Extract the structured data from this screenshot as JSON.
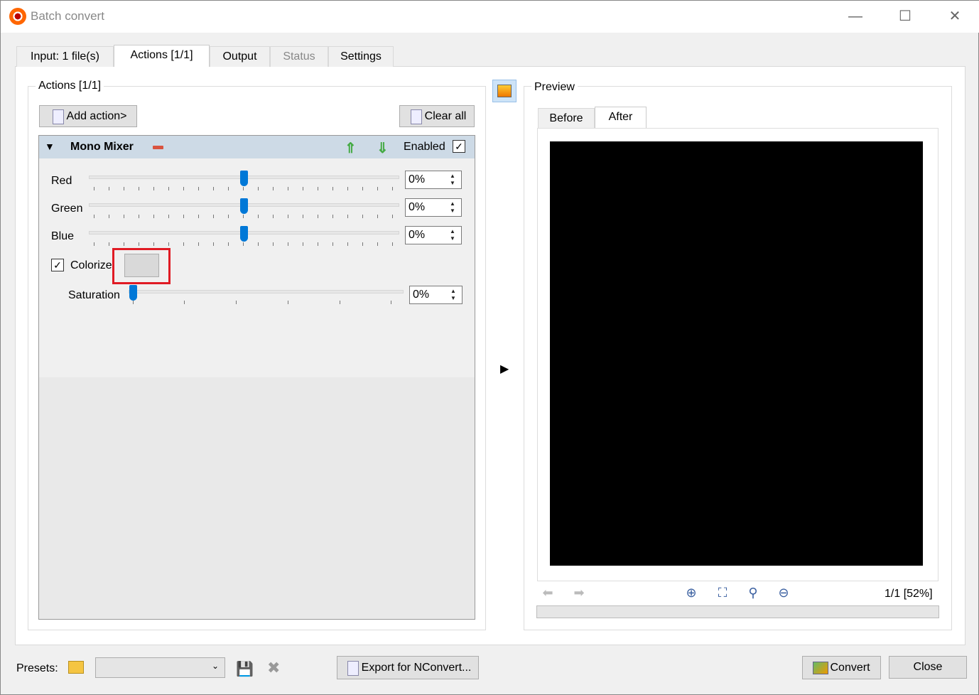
{
  "window": {
    "title": "Batch convert"
  },
  "tabs": [
    {
      "label": "Input: 1 file(s)"
    },
    {
      "label": "Actions [1/1]"
    },
    {
      "label": "Output"
    },
    {
      "label": "Status"
    },
    {
      "label": "Settings"
    }
  ],
  "actions": {
    "group_title": "Actions [1/1]",
    "add_action": "Add action>",
    "clear_all": "Clear all",
    "action": {
      "name": "Mono Mixer",
      "enabled_label": "Enabled",
      "enabled": true,
      "sliders": [
        {
          "label": "Red",
          "value": "0%"
        },
        {
          "label": "Green",
          "value": "0%"
        },
        {
          "label": "Blue",
          "value": "0%"
        }
      ],
      "colorize_label": "Colorize",
      "colorize_checked": true,
      "colorize_color": "#d9d9d9",
      "saturation": {
        "label": "Saturation",
        "value": "0%"
      }
    }
  },
  "preview": {
    "group_title": "Preview",
    "tabs": [
      {
        "label": "Before"
      },
      {
        "label": "After"
      }
    ],
    "page_info": "1/1 [52%]"
  },
  "bottom": {
    "presets_label": "Presets:",
    "preset_value": "",
    "export_label": "Export for NConvert...",
    "convert_label": "Convert",
    "close_label": "Close"
  }
}
